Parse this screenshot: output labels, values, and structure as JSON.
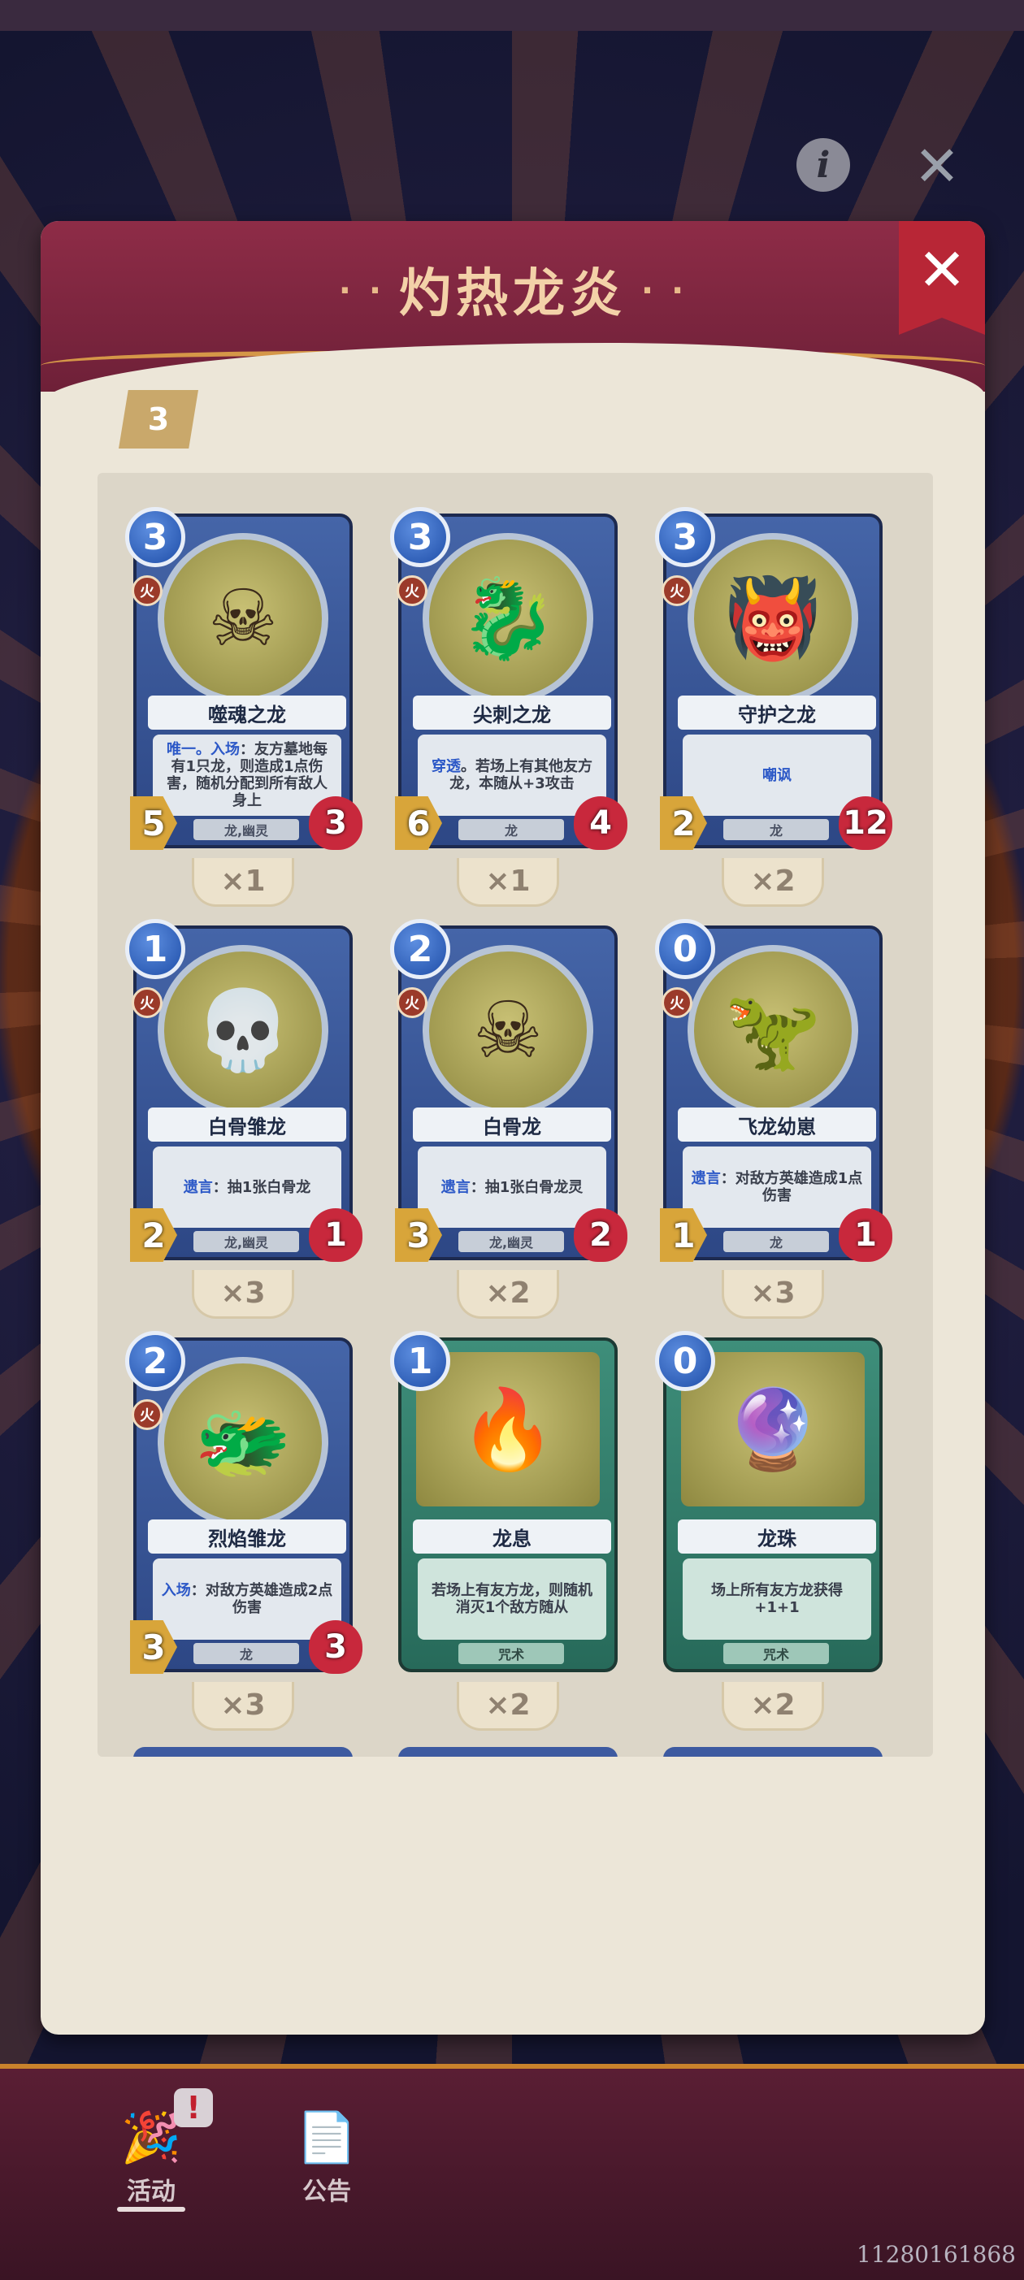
{
  "header": {
    "title": "灼热龙炎",
    "deck_count": "3"
  },
  "icons": {
    "info": "info-icon",
    "close": "close-icon"
  },
  "cards": [
    {
      "name": "噬魂之龙",
      "cost": "3",
      "element": "火",
      "attack": "5",
      "health": "3",
      "tribe": "龙,幽灵",
      "kw": "唯一。入场",
      "text": "：友方墓地每有1只龙，则造成1点伤害，随机分配到所有敌人身上",
      "qty": "×1",
      "type": "minion",
      "art": "☠"
    },
    {
      "name": "尖刺之龙",
      "cost": "3",
      "element": "火",
      "attack": "6",
      "health": "4",
      "tribe": "龙",
      "kw": "穿透",
      "text": "。若场上有其他友方龙，本随从+3攻击",
      "qty": "×1",
      "type": "minion",
      "art": "🐉"
    },
    {
      "name": "守护之龙",
      "cost": "3",
      "element": "火",
      "attack": "2",
      "health": "12",
      "tribe": "龙",
      "kw": "嘲讽",
      "text": "",
      "qty": "×2",
      "type": "minion",
      "art": "👹"
    },
    {
      "name": "白骨雏龙",
      "cost": "1",
      "element": "火",
      "attack": "2",
      "health": "1",
      "tribe": "龙,幽灵",
      "kw": "遗言",
      "text": "：抽1张白骨龙",
      "qty": "×3",
      "type": "minion",
      "art": "💀"
    },
    {
      "name": "白骨龙",
      "cost": "2",
      "element": "火",
      "attack": "3",
      "health": "2",
      "tribe": "龙,幽灵",
      "kw": "遗言",
      "text": "：抽1张白骨龙灵",
      "qty": "×2",
      "type": "minion",
      "art": "☠"
    },
    {
      "name": "飞龙幼崽",
      "cost": "0",
      "element": "火",
      "attack": "1",
      "health": "1",
      "tribe": "龙",
      "kw": "遗言",
      "text": "：对敌方英雄造成1点伤害",
      "qty": "×3",
      "type": "minion",
      "art": "🦖"
    },
    {
      "name": "烈焰雏龙",
      "cost": "2",
      "element": "火",
      "attack": "3",
      "health": "3",
      "tribe": "龙",
      "kw": "入场",
      "text": "：对敌方英雄造成2点伤害",
      "qty": "×3",
      "type": "minion",
      "art": "🐲"
    },
    {
      "name": "龙息",
      "cost": "1",
      "element": "",
      "attack": "",
      "health": "",
      "tribe": "咒术",
      "kw": "",
      "text": "若场上有友方龙，则随机消灭1个敌方随从",
      "qty": "×2",
      "type": "spell",
      "art": "🔥"
    },
    {
      "name": "龙珠",
      "cost": "0",
      "element": "",
      "attack": "",
      "health": "",
      "tribe": "咒术",
      "kw": "",
      "text": "场上所有友方龙获得+1+1",
      "qty": "×2",
      "type": "spell",
      "art": "🔮"
    }
  ],
  "nav": {
    "activity": "活动",
    "notice": "公告",
    "badge": "!"
  },
  "uid": "11280161868",
  "colors": {
    "panel_header": "#8e2c47",
    "card_minion": "#4565a8",
    "card_spell": "#3e8e7a",
    "close_ribbon": "#b82636"
  }
}
